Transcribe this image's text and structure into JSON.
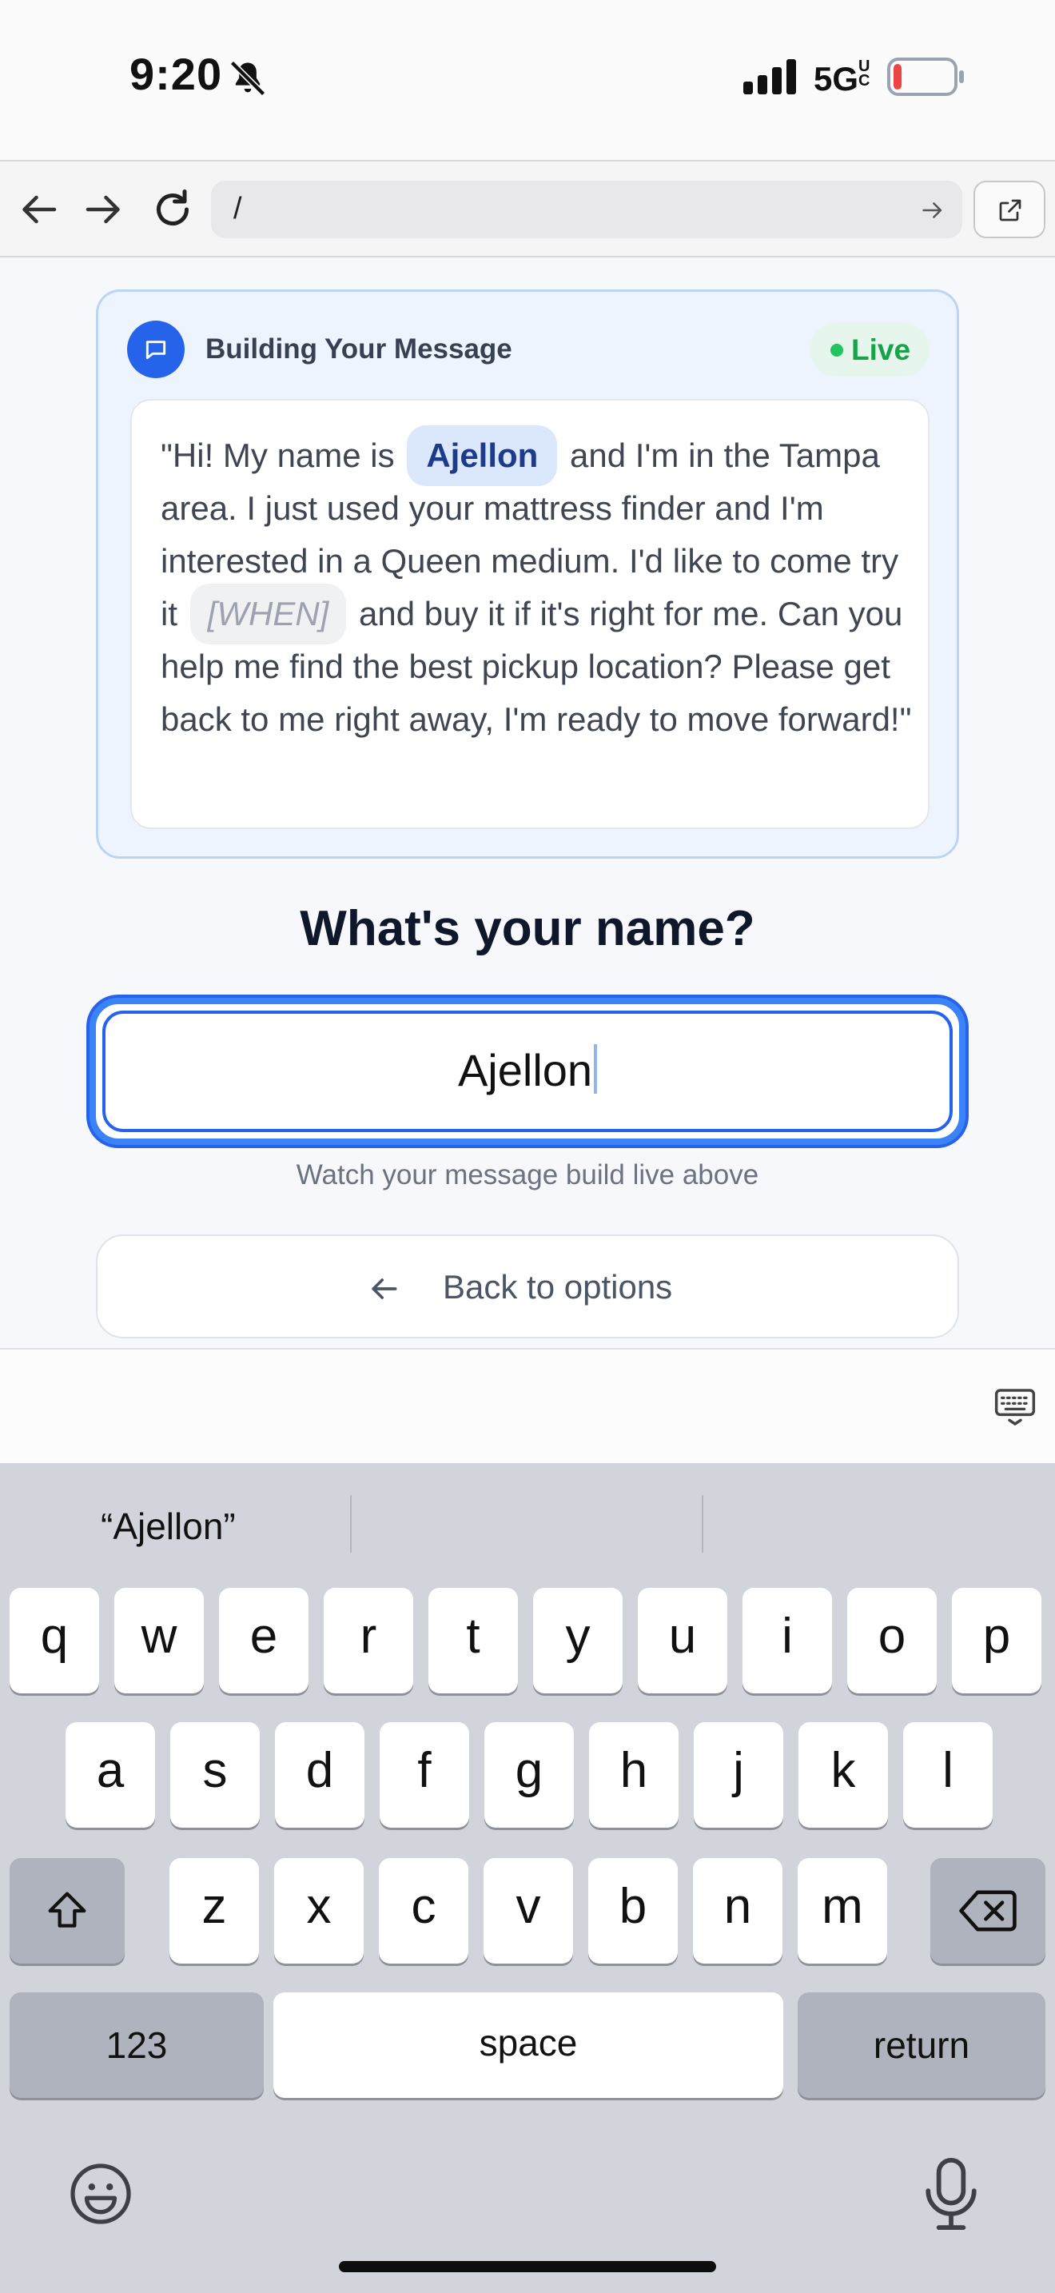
{
  "status_bar": {
    "time": "9:20",
    "network": "5G",
    "network_suffix": "UC",
    "battery_color": "#ef4444"
  },
  "browser": {
    "url": "/"
  },
  "message_card": {
    "title": "Building Your Message",
    "live_label": "Live",
    "message_before_name": "\"Hi! My name is",
    "name_chip": "Ajellon",
    "message_middle": "and I'm in the Tampa area. I just used your mattress finder and I'm interested in a Queen medium. I'd like to come try it",
    "when_chip": "[WHEN]",
    "message_after": "and buy it if it's right for me. Can you help me find the best pickup location? Please get back to me right away, I'm ready to move forward!\""
  },
  "form": {
    "question": "What's your name?",
    "name_value": "Ajellon",
    "hint": "Watch your message build live above",
    "back_label": "Back to options"
  },
  "keyboard": {
    "suggestions": [
      "“Ajellon”",
      "",
      ""
    ],
    "row1": [
      "q",
      "w",
      "e",
      "r",
      "t",
      "y",
      "u",
      "i",
      "o",
      "p"
    ],
    "row2": [
      "a",
      "s",
      "d",
      "f",
      "g",
      "h",
      "j",
      "k",
      "l"
    ],
    "row3": [
      "z",
      "x",
      "c",
      "v",
      "b",
      "n",
      "m"
    ],
    "numbers_label": "123",
    "space_label": "space",
    "return_label": "return"
  },
  "colors": {
    "accent": "#2563eb",
    "live_green": "#16a34a"
  }
}
